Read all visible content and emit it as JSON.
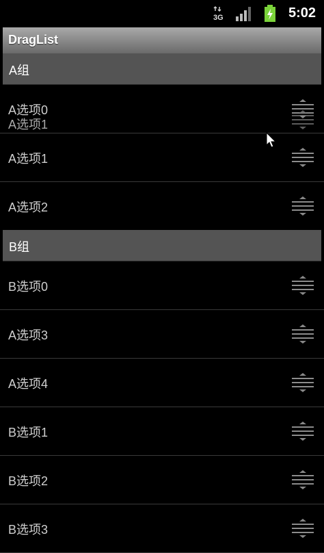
{
  "status_bar": {
    "time": "5:02",
    "icons": [
      "3g-data-icon",
      "signal-strength-icon",
      "battery-charging-icon"
    ]
  },
  "app": {
    "title": "DragList"
  },
  "groups": [
    {
      "label": "A组",
      "items": [
        "A选项0",
        "A选项1",
        "A选项2"
      ]
    },
    {
      "label": "B组",
      "items": [
        "B选项0",
        "A选项3",
        "A选项4",
        "B选项1",
        "B选项2",
        "B选项3"
      ]
    }
  ],
  "dragging": {
    "label": "A选项1",
    "icon": "drag-handle-icon"
  },
  "colors": {
    "background": "#000000",
    "group_header": "#545454",
    "title_bar_top": "#a9a9a9",
    "title_bar_bottom": "#6a6a6a",
    "battery": "#7bd33a"
  }
}
